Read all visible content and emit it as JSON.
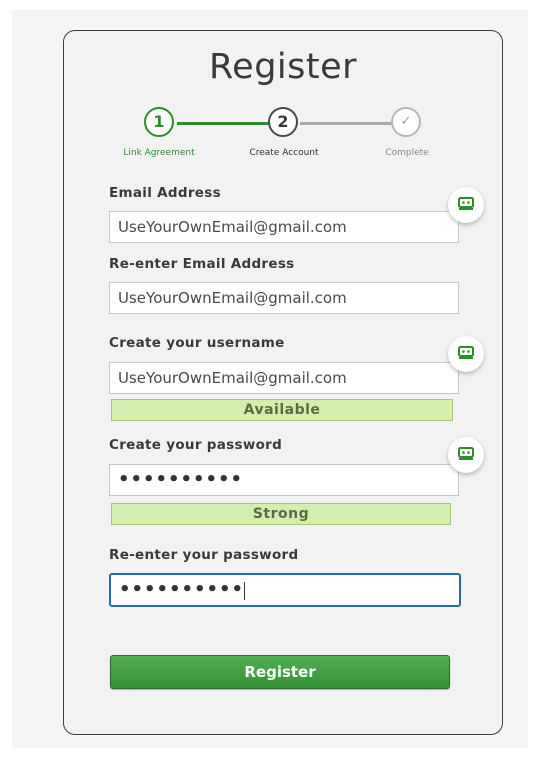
{
  "form": {
    "title": "Register",
    "steps": [
      {
        "number": "1",
        "label": "Link Agreement",
        "state": "done"
      },
      {
        "number": "2",
        "label": "Create Account",
        "state": "current"
      },
      {
        "number": "✓",
        "label": "Complete",
        "state": "pending"
      }
    ],
    "email": {
      "label": "Email Address",
      "value": "UseYourOwnEmail@gmail.com"
    },
    "email_confirm": {
      "label": "Re-enter Email Address",
      "value": "UseYourOwnEmail@gmail.com"
    },
    "username": {
      "label": "Create your username",
      "value": "UseYourOwnEmail@gmail.com",
      "status": "Available"
    },
    "password": {
      "label": "Create your password",
      "dots": "••••••••••",
      "status": "Strong"
    },
    "password_confirm": {
      "label": "Re-enter your password",
      "dots": "••••••••••"
    },
    "submit_label": "Register"
  },
  "colors": {
    "accent_green": "#2e8b2e",
    "status_bg": "#d3eeae",
    "focus_blue": "#2f64b0"
  },
  "icons": {
    "field_badge": "password-manager-icon"
  }
}
